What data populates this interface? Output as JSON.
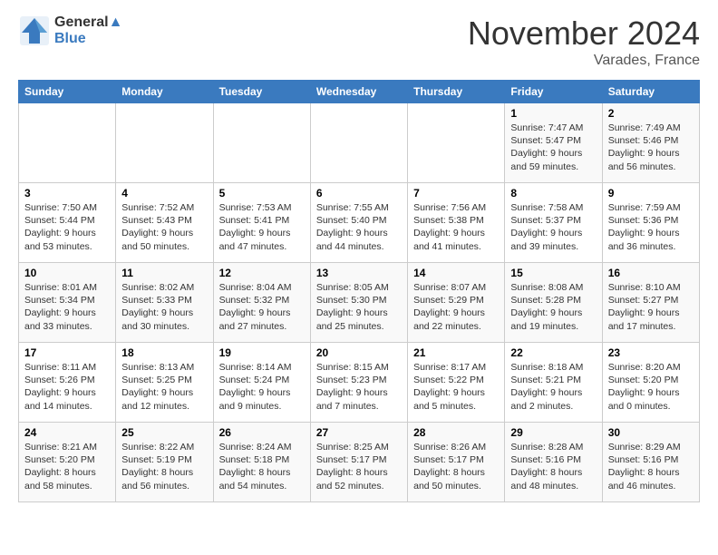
{
  "header": {
    "logo_line1": "General",
    "logo_line2": "Blue",
    "title": "November 2024",
    "location": "Varades, France"
  },
  "days_of_week": [
    "Sunday",
    "Monday",
    "Tuesday",
    "Wednesday",
    "Thursday",
    "Friday",
    "Saturday"
  ],
  "weeks": [
    [
      {
        "day": "",
        "info": ""
      },
      {
        "day": "",
        "info": ""
      },
      {
        "day": "",
        "info": ""
      },
      {
        "day": "",
        "info": ""
      },
      {
        "day": "",
        "info": ""
      },
      {
        "day": "1",
        "info": "Sunrise: 7:47 AM\nSunset: 5:47 PM\nDaylight: 9 hours and 59 minutes."
      },
      {
        "day": "2",
        "info": "Sunrise: 7:49 AM\nSunset: 5:46 PM\nDaylight: 9 hours and 56 minutes."
      }
    ],
    [
      {
        "day": "3",
        "info": "Sunrise: 7:50 AM\nSunset: 5:44 PM\nDaylight: 9 hours and 53 minutes."
      },
      {
        "day": "4",
        "info": "Sunrise: 7:52 AM\nSunset: 5:43 PM\nDaylight: 9 hours and 50 minutes."
      },
      {
        "day": "5",
        "info": "Sunrise: 7:53 AM\nSunset: 5:41 PM\nDaylight: 9 hours and 47 minutes."
      },
      {
        "day": "6",
        "info": "Sunrise: 7:55 AM\nSunset: 5:40 PM\nDaylight: 9 hours and 44 minutes."
      },
      {
        "day": "7",
        "info": "Sunrise: 7:56 AM\nSunset: 5:38 PM\nDaylight: 9 hours and 41 minutes."
      },
      {
        "day": "8",
        "info": "Sunrise: 7:58 AM\nSunset: 5:37 PM\nDaylight: 9 hours and 39 minutes."
      },
      {
        "day": "9",
        "info": "Sunrise: 7:59 AM\nSunset: 5:36 PM\nDaylight: 9 hours and 36 minutes."
      }
    ],
    [
      {
        "day": "10",
        "info": "Sunrise: 8:01 AM\nSunset: 5:34 PM\nDaylight: 9 hours and 33 minutes."
      },
      {
        "day": "11",
        "info": "Sunrise: 8:02 AM\nSunset: 5:33 PM\nDaylight: 9 hours and 30 minutes."
      },
      {
        "day": "12",
        "info": "Sunrise: 8:04 AM\nSunset: 5:32 PM\nDaylight: 9 hours and 27 minutes."
      },
      {
        "day": "13",
        "info": "Sunrise: 8:05 AM\nSunset: 5:30 PM\nDaylight: 9 hours and 25 minutes."
      },
      {
        "day": "14",
        "info": "Sunrise: 8:07 AM\nSunset: 5:29 PM\nDaylight: 9 hours and 22 minutes."
      },
      {
        "day": "15",
        "info": "Sunrise: 8:08 AM\nSunset: 5:28 PM\nDaylight: 9 hours and 19 minutes."
      },
      {
        "day": "16",
        "info": "Sunrise: 8:10 AM\nSunset: 5:27 PM\nDaylight: 9 hours and 17 minutes."
      }
    ],
    [
      {
        "day": "17",
        "info": "Sunrise: 8:11 AM\nSunset: 5:26 PM\nDaylight: 9 hours and 14 minutes."
      },
      {
        "day": "18",
        "info": "Sunrise: 8:13 AM\nSunset: 5:25 PM\nDaylight: 9 hours and 12 minutes."
      },
      {
        "day": "19",
        "info": "Sunrise: 8:14 AM\nSunset: 5:24 PM\nDaylight: 9 hours and 9 minutes."
      },
      {
        "day": "20",
        "info": "Sunrise: 8:15 AM\nSunset: 5:23 PM\nDaylight: 9 hours and 7 minutes."
      },
      {
        "day": "21",
        "info": "Sunrise: 8:17 AM\nSunset: 5:22 PM\nDaylight: 9 hours and 5 minutes."
      },
      {
        "day": "22",
        "info": "Sunrise: 8:18 AM\nSunset: 5:21 PM\nDaylight: 9 hours and 2 minutes."
      },
      {
        "day": "23",
        "info": "Sunrise: 8:20 AM\nSunset: 5:20 PM\nDaylight: 9 hours and 0 minutes."
      }
    ],
    [
      {
        "day": "24",
        "info": "Sunrise: 8:21 AM\nSunset: 5:20 PM\nDaylight: 8 hours and 58 minutes."
      },
      {
        "day": "25",
        "info": "Sunrise: 8:22 AM\nSunset: 5:19 PM\nDaylight: 8 hours and 56 minutes."
      },
      {
        "day": "26",
        "info": "Sunrise: 8:24 AM\nSunset: 5:18 PM\nDaylight: 8 hours and 54 minutes."
      },
      {
        "day": "27",
        "info": "Sunrise: 8:25 AM\nSunset: 5:17 PM\nDaylight: 8 hours and 52 minutes."
      },
      {
        "day": "28",
        "info": "Sunrise: 8:26 AM\nSunset: 5:17 PM\nDaylight: 8 hours and 50 minutes."
      },
      {
        "day": "29",
        "info": "Sunrise: 8:28 AM\nSunset: 5:16 PM\nDaylight: 8 hours and 48 minutes."
      },
      {
        "day": "30",
        "info": "Sunrise: 8:29 AM\nSunset: 5:16 PM\nDaylight: 8 hours and 46 minutes."
      }
    ]
  ]
}
